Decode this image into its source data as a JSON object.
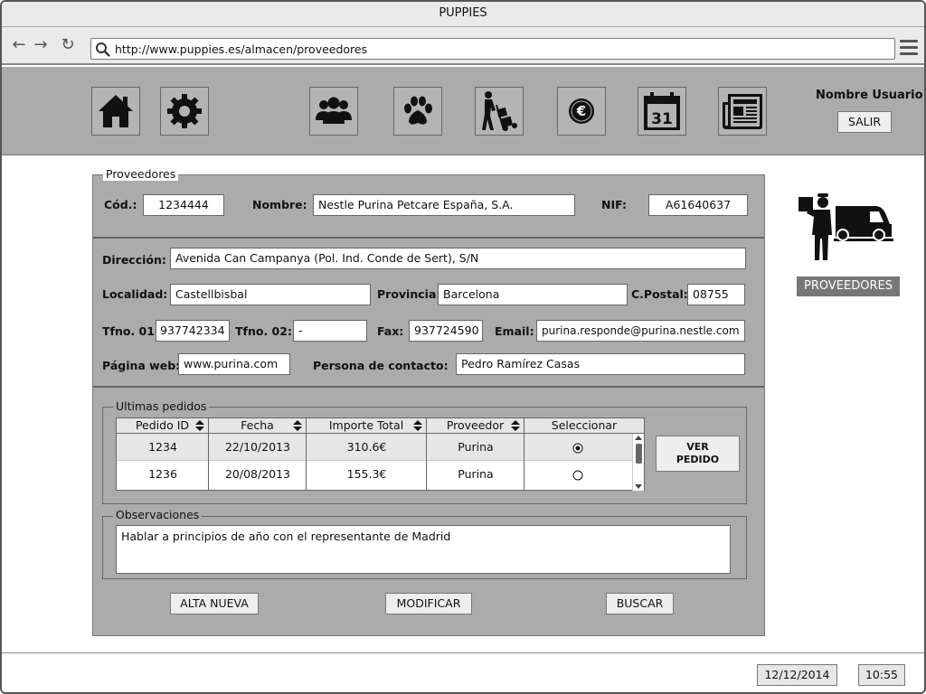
{
  "window": {
    "title": "PUPPIES"
  },
  "browser": {
    "url": "http://www.puppies.es/almacen/proveedores"
  },
  "toolbar": {
    "icons": [
      "home-icon",
      "gear-icon",
      "people-icon",
      "paw-icon",
      "delivery-icon",
      "euro-icon",
      "calendar-icon",
      "newspaper-icon"
    ],
    "calendar_day": "31",
    "username": "Nombre Usuario",
    "logout_label": "SALIR"
  },
  "form": {
    "legend": "Proveedores",
    "cod_label": "Cód.:",
    "cod_value": "1234444",
    "nombre_label": "Nombre:",
    "nombre_value": "Nestle Purina Petcare España, S.A.",
    "nif_label": "NIF:",
    "nif_value": "A61640637",
    "direccion_label": "Dirección:",
    "direccion_value": "Avenida Can Campanya (Pol. Ind. Conde de Sert), S/N",
    "localidad_label": "Localidad:",
    "localidad_value": "Castellbisbal",
    "provincia_label": "Provincia:",
    "provincia_value": "Barcelona",
    "cpostal_label": "C.Postal:",
    "cpostal_value": "08755",
    "tfno1_label": "Tfno. 01:",
    "tfno1_value": "937742334",
    "tfno2_label": "Tfno. 02:",
    "tfno2_value": "-",
    "fax_label": "Fax:",
    "fax_value": "937724590",
    "email_label": "Email:",
    "email_value": "purina.responde@purina.nestle.com",
    "web_label": "Página web:",
    "web_value": "www.purina.com",
    "contacto_label": "Persona de contacto:",
    "contacto_value": "Pedro Ramírez Casas"
  },
  "orders": {
    "legend": "Ultimas pedidos",
    "columns": [
      "Pedido ID",
      "Fecha",
      "Importe Total",
      "Proveedor",
      "Seleccionar"
    ],
    "rows": [
      {
        "id": "1234",
        "fecha": "22/10/2013",
        "importe": "310.6€",
        "proveedor": "Purina",
        "selected": true
      },
      {
        "id": "1236",
        "fecha": "20/08/2013",
        "importe": "155.3€",
        "proveedor": "Purina",
        "selected": false
      }
    ],
    "view_button_line1": "VER",
    "view_button_line2": "PEDIDO"
  },
  "observations": {
    "legend": "Observaciones",
    "text": "Hablar a principios de año con el representante de Madrid"
  },
  "actions": {
    "new_label": "ALTA NUEVA",
    "edit_label": "MODIFICAR",
    "search_label": "BUSCAR"
  },
  "section": {
    "label": "PROVEEDORES"
  },
  "footer": {
    "date": "12/12/2014",
    "time": "10:55"
  }
}
